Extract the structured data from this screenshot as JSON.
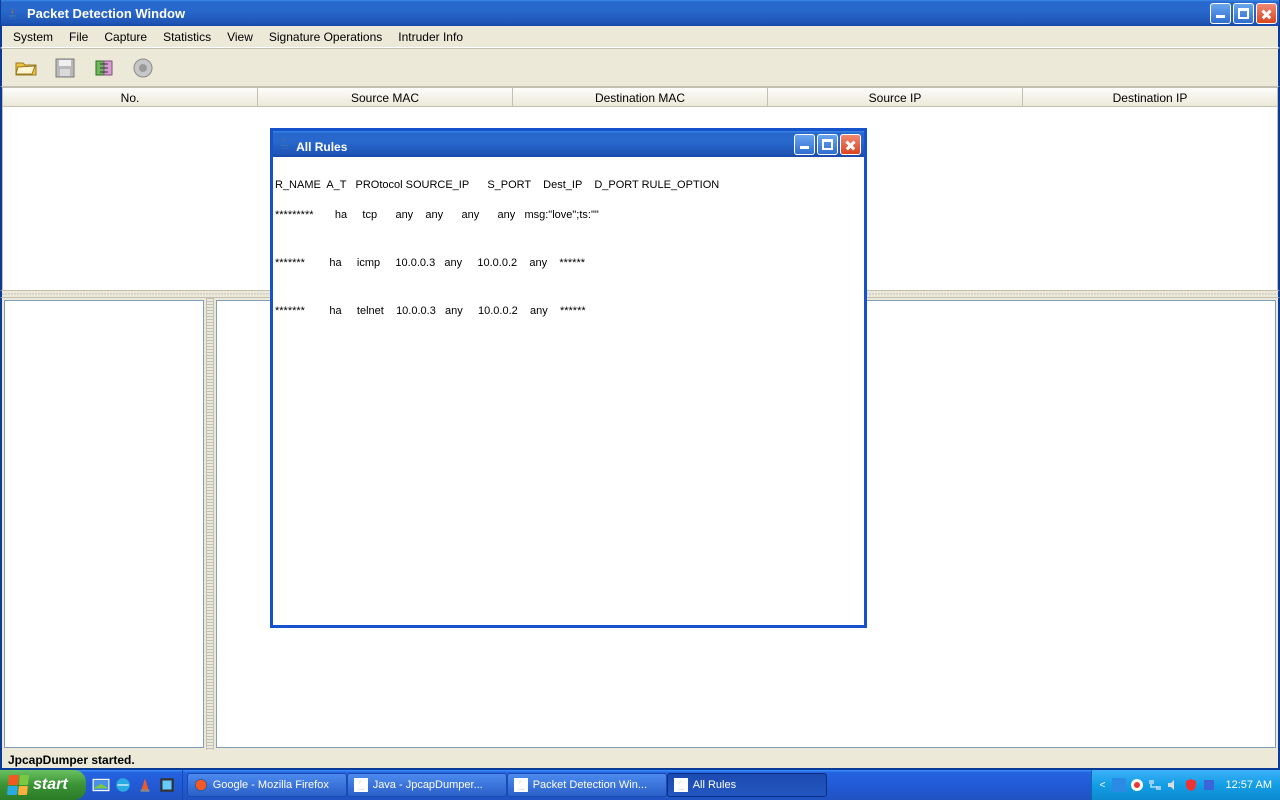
{
  "main_window": {
    "title": "Packet Detection Window"
  },
  "menubar": {
    "items": [
      "System",
      "File",
      "Capture",
      "Statistics",
      "View",
      "Signature Operations",
      "Intruder Info"
    ]
  },
  "table": {
    "columns": [
      "No.",
      "Source MAC",
      "Destination MAC",
      "Source IP",
      "Destination IP"
    ]
  },
  "status": {
    "text": "JpcapDumper started."
  },
  "inner_window": {
    "title": "All Rules",
    "header": "R_NAME  A_T   PROtocol SOURCE_IP      S_PORT    Dest_IP    D_PORT RULE_OPTION",
    "rows": [
      "*********       ha     tcp      any    any      any      any   msg:\"love\";ts:\"\"",
      "",
      "*******        ha     icmp     10.0.0.3   any     10.0.0.2    any    ******",
      "",
      "*******        ha     telnet    10.0.0.3   any     10.0.0.2    any    ******"
    ]
  },
  "taskbar": {
    "start": "start",
    "items": [
      {
        "label": "Google - Mozilla Firefox",
        "active": false,
        "icon": "firefox"
      },
      {
        "label": "Java - JpcapDumper...",
        "active": false,
        "icon": "java"
      },
      {
        "label": "Packet Detection Win...",
        "active": false,
        "icon": "java"
      },
      {
        "label": "All Rules",
        "active": true,
        "icon": "java"
      }
    ],
    "clock": "12:57 AM"
  }
}
